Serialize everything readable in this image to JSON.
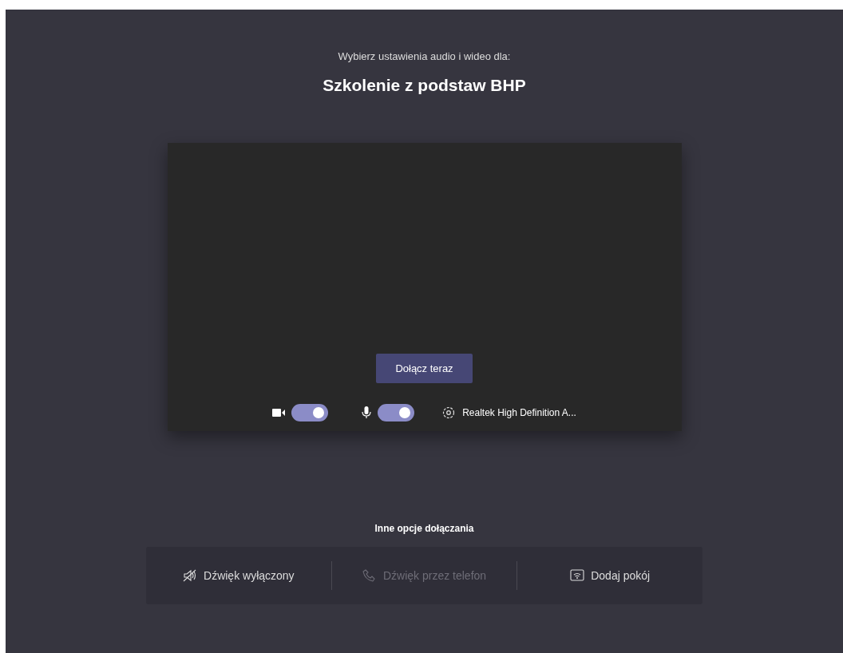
{
  "header": {
    "subtitle": "Wybierz ustawienia audio i wideo dla:",
    "title": "Szkolenie z podstaw BHP"
  },
  "preview": {
    "join_button": "Dołącz teraz",
    "camera_on": true,
    "mic_on": true,
    "audio_device": "Realtek High Definition A..."
  },
  "other_options": {
    "heading": "Inne opcje dołączania",
    "options": [
      {
        "kind": "audio-off",
        "label": "Dźwięk wyłączony",
        "disabled": false
      },
      {
        "kind": "phone",
        "label": "Dźwięk przez telefon",
        "disabled": true
      },
      {
        "kind": "room",
        "label": "Dodaj pokój",
        "disabled": false
      }
    ]
  }
}
